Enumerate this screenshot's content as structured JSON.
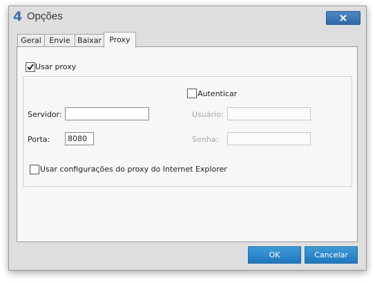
{
  "window": {
    "icon_label": "4",
    "title": "Opções",
    "close_icon": "close-x-icon"
  },
  "tabs": [
    {
      "label": "Geral",
      "active": false
    },
    {
      "label": "Envie",
      "active": false
    },
    {
      "label": "Baixar",
      "active": false
    },
    {
      "label": "Proxy",
      "active": true
    }
  ],
  "proxy": {
    "use_proxy_label": "Usar proxy",
    "use_proxy_checked": true,
    "authenticate_label": "Autenticar",
    "authenticate_checked": false,
    "server_label": "Servidor:",
    "server_value": "",
    "port_label": "Porta:",
    "port_value": "8080",
    "user_label": "Usuário:",
    "user_value": "",
    "password_label": "Senha:",
    "password_value": "",
    "ie_proxy_label": "Usar configurações do proxy do Internet Explorer",
    "ie_proxy_checked": false
  },
  "buttons": {
    "ok": "OK",
    "cancel": "Cancelar"
  },
  "colors": {
    "accent": "#2f7ec4",
    "dialog_bg": "#dedede",
    "panel_bg": "#f7f7f7"
  }
}
